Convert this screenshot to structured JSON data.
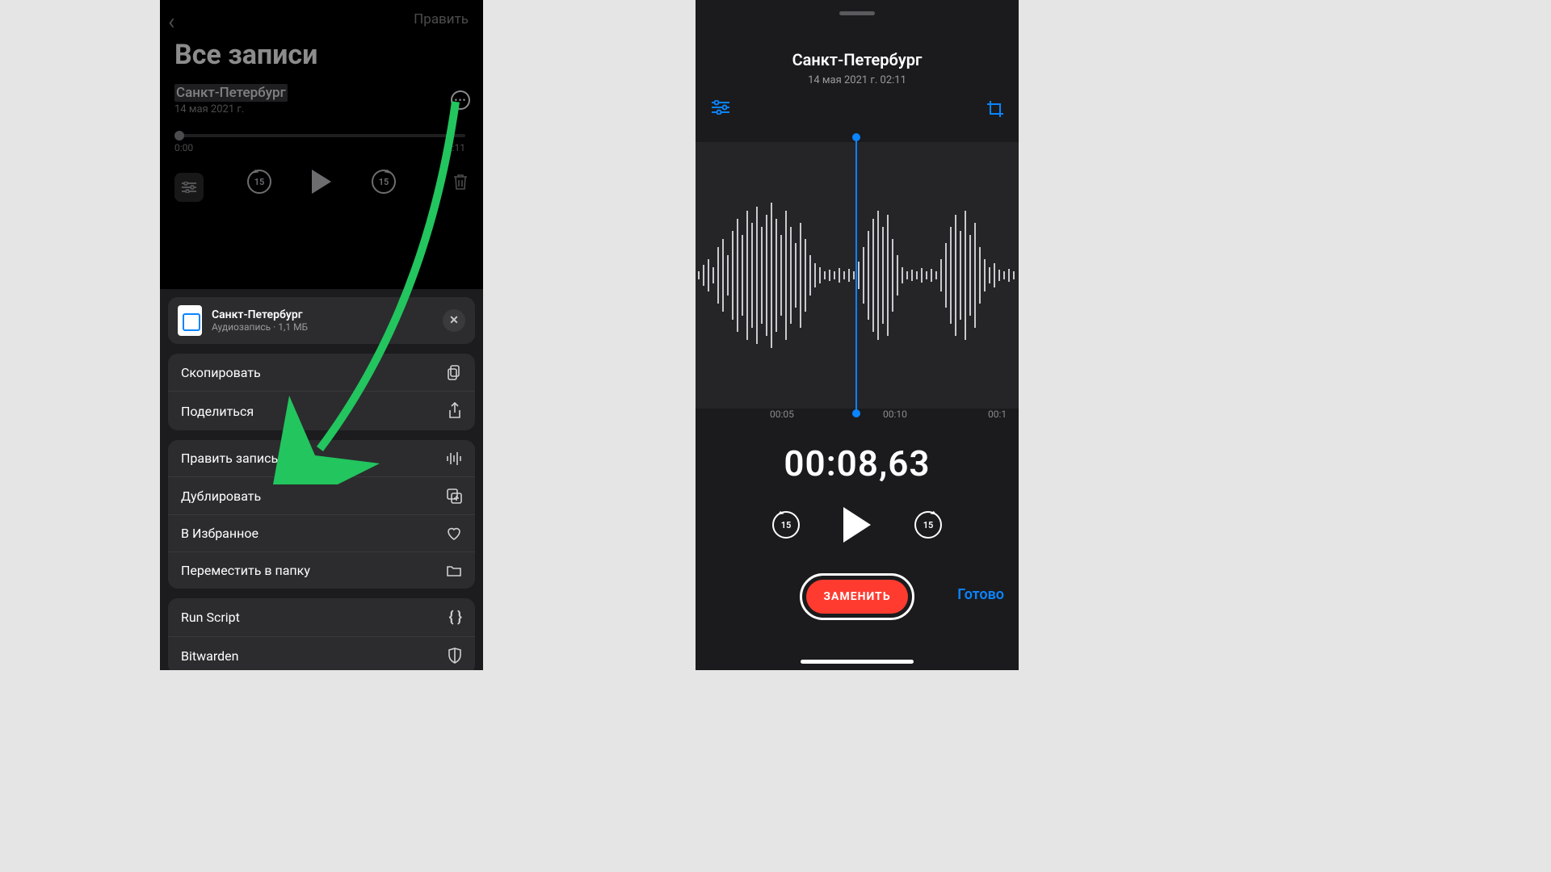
{
  "left": {
    "edit_link": "Править",
    "page_title": "Все записи",
    "recording": {
      "title": "Санкт-Петербург",
      "date": "14 мая 2021 г."
    },
    "time_start": "0:00",
    "time_end": "2:11",
    "skip_value": "15",
    "sheet_header": {
      "title": "Санкт-Петербург",
      "subtitle": "Аудиозапись · 1,1 МБ"
    },
    "actions_g1": [
      {
        "label": "Скопировать",
        "icon": "copy"
      },
      {
        "label": "Поделиться",
        "icon": "share"
      }
    ],
    "actions_g2": [
      {
        "label": "Править запись",
        "icon": "wave"
      },
      {
        "label": "Дублировать",
        "icon": "duplicate"
      },
      {
        "label": "В Избранное",
        "icon": "heart"
      },
      {
        "label": "Переместить в папку",
        "icon": "folder"
      }
    ],
    "actions_g3": [
      {
        "label": "Run Script",
        "icon": "braces"
      },
      {
        "label": "Bitwarden",
        "icon": "shield"
      }
    ]
  },
  "right": {
    "title": "Санкт-Петербург",
    "subtitle": "14 мая 2021 г.   02:11",
    "ruler": [
      "00:05",
      "00:10",
      "00:1"
    ],
    "timecode": "00:08,63",
    "skip_value": "15",
    "replace_label": "ЗАМЕНИТЬ",
    "done_label": "Готово"
  },
  "annotation": {
    "arrow_color": "#22c55e"
  }
}
